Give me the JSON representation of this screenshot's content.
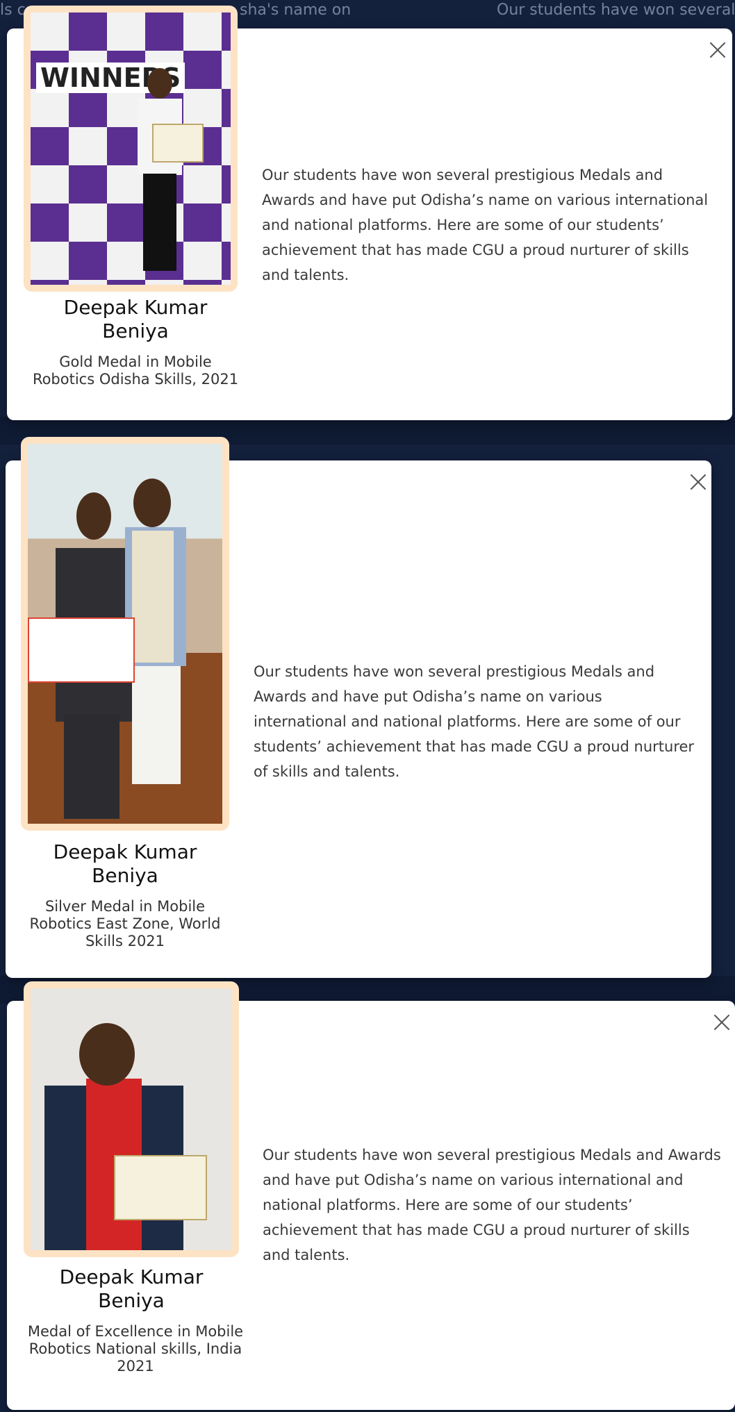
{
  "background": {
    "text_a": "ls c",
    "text_b": "sha's name on",
    "text_c": "Our students have won several p"
  },
  "modals": [
    {
      "name": "Deepak Kumar Beniya",
      "award": "Gold Medal in Mobile Robotics Odisha Skills, 2021",
      "photo_text": "WINNERS",
      "description": "Our students have won several prestigious Medals and Awards and have put Odisha’s name on various international and national platforms. Here are some of our students’ achievement that has made CGU a proud nurturer of skills and talents."
    },
    {
      "name": "Deepak Kumar Beniya",
      "award": "Silver Medal in Mobile Robotics East Zone, World Skills 2021",
      "photo_text": "",
      "description": "Our students have won several prestigious Medals and Awards and have put Odisha’s name on various international and national platforms. Here are some of our students’ achievement that has made CGU a proud nurturer of skills and talents."
    },
    {
      "name": "Deepak Kumar Beniya",
      "award": "Medal of Excellence in Mobile Robotics National skills, India 2021",
      "photo_text": "",
      "description": "Our students have won several prestigious Medals and Awards and have put Odisha’s name on various international and national platforms. Here are some of our students’ achievement that has made CGU a proud nurturer of skills and talents."
    }
  ],
  "colors": {
    "page_bg": "#14213d",
    "photo_frame": "#fde3c4",
    "modal_bg": "#ffffff"
  },
  "icons": {
    "close": "close-icon"
  }
}
